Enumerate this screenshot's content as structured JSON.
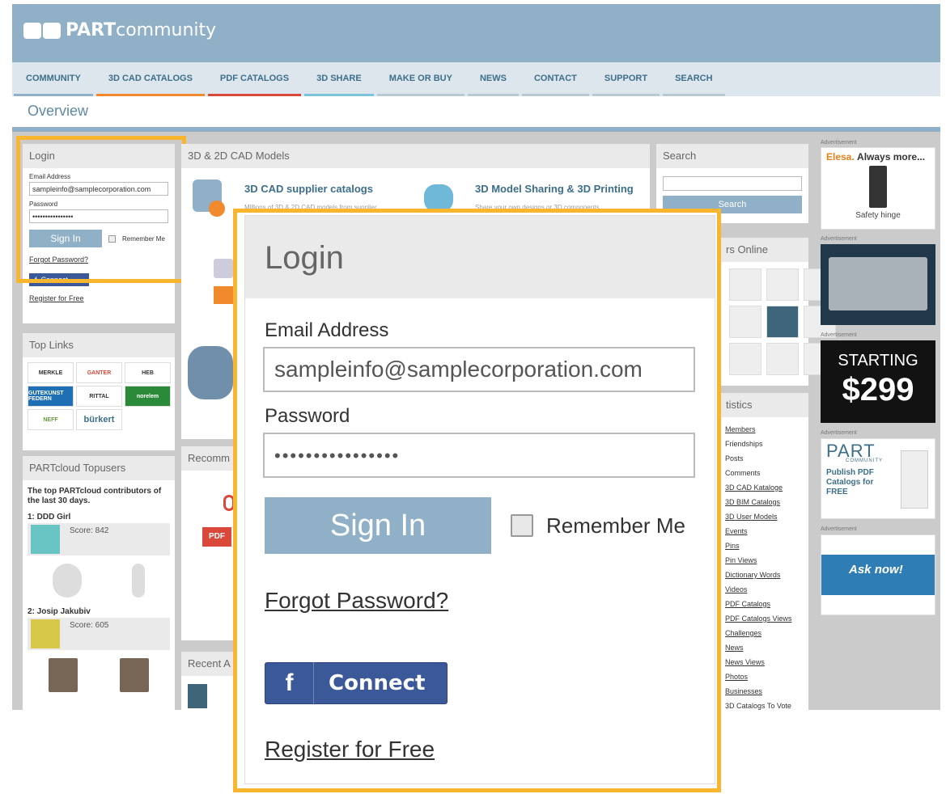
{
  "header": {
    "brand_bold": "PART",
    "brand_light": "community"
  },
  "nav": {
    "items": [
      "COMMUNITY",
      "3D CAD CATALOGS",
      "PDF CATALOGS",
      "3D SHARE",
      "MAKE OR BUY",
      "NEWS",
      "CONTACT",
      "SUPPORT",
      "SEARCH"
    ]
  },
  "page_title": "Overview",
  "login": {
    "title": "Login",
    "email_label": "Email Address",
    "email_value": "sampleinfo@samplecorporation.com",
    "password_label": "Password",
    "password_value": "••••••••••••••••",
    "sign_in": "Sign In",
    "remember": "Remember Me",
    "forgot": "Forgot Password?",
    "fb_icon": "f",
    "fb_connect": "Connect",
    "register": "Register for Free"
  },
  "toplinks": {
    "title": "Top Links",
    "logos": [
      "MERKLE",
      "GANTER",
      "HEB",
      "GUTEKUNST FEDERN",
      "RITTAL",
      "norelem",
      "NEFF",
      "bürkert",
      ""
    ]
  },
  "topusers": {
    "title": "PARTcloud Topusers",
    "desc": "The top PARTcloud contributors of the last 30 days.",
    "users": [
      {
        "name": "1: DDD Girl",
        "score": "Score: 842"
      },
      {
        "name": "2: Josip Jakubiv",
        "score": "Score: 605"
      }
    ]
  },
  "center": {
    "cad_title": "3D & 2D CAD Models",
    "supplier": "3D CAD supplier catalogs",
    "supplier_fine": "Millions of 3D & 2D CAD models from supplier",
    "sharing": "3D Model Sharing & 3D Printing",
    "sharing_fine": "Share your own designs or 3D components",
    "recommended": "Recomm",
    "pdf": "PDF",
    "recent": "Recent A"
  },
  "search": {
    "title": "Search",
    "button": "Search"
  },
  "online": {
    "title": "rs Online"
  },
  "stats": {
    "title": "tistics",
    "items": [
      {
        "label": "Members",
        "link": true
      },
      {
        "label": "Friendships",
        "link": false
      },
      {
        "label": "Posts",
        "link": false
      },
      {
        "label": "Comments",
        "link": false
      },
      {
        "label": "3D CAD Kataloge",
        "link": true
      },
      {
        "label": "3D BIM Catalogs",
        "link": true
      },
      {
        "label": "3D User Models",
        "link": true
      },
      {
        "label": "Events",
        "link": true
      },
      {
        "label": "Pins",
        "link": true
      },
      {
        "label": "Pin Views",
        "link": true
      },
      {
        "label": "Dictionary Words",
        "link": true
      },
      {
        "label": "Videos",
        "link": true
      },
      {
        "label": "PDF Catalogs",
        "link": true
      },
      {
        "label": "PDF Catalogs Views",
        "link": true
      },
      {
        "label": "Challenges",
        "link": true
      },
      {
        "label": "News",
        "link": true
      },
      {
        "label": "News Views",
        "link": true
      },
      {
        "label": "Photos",
        "link": true
      },
      {
        "label": "Businesses",
        "link": true
      },
      {
        "label": "3D Catalogs To Vote",
        "link": false
      }
    ]
  },
  "ads": {
    "label": "Advertisement",
    "elesa_brand": "Elesa.",
    "elesa_tag": "Always more...",
    "elesa_caption": "Safety hinge",
    "starting": "STARTING",
    "price": "$299",
    "part_logo": "PART",
    "part_sub": "COMMUNITY",
    "part_text": "Publish PDF Catalogs for FREE",
    "ask": "Ask",
    "now": "now!"
  },
  "colors": {
    "header": "#8fb0c6",
    "highlight": "#f9b52d",
    "facebook": "#3b5998"
  }
}
